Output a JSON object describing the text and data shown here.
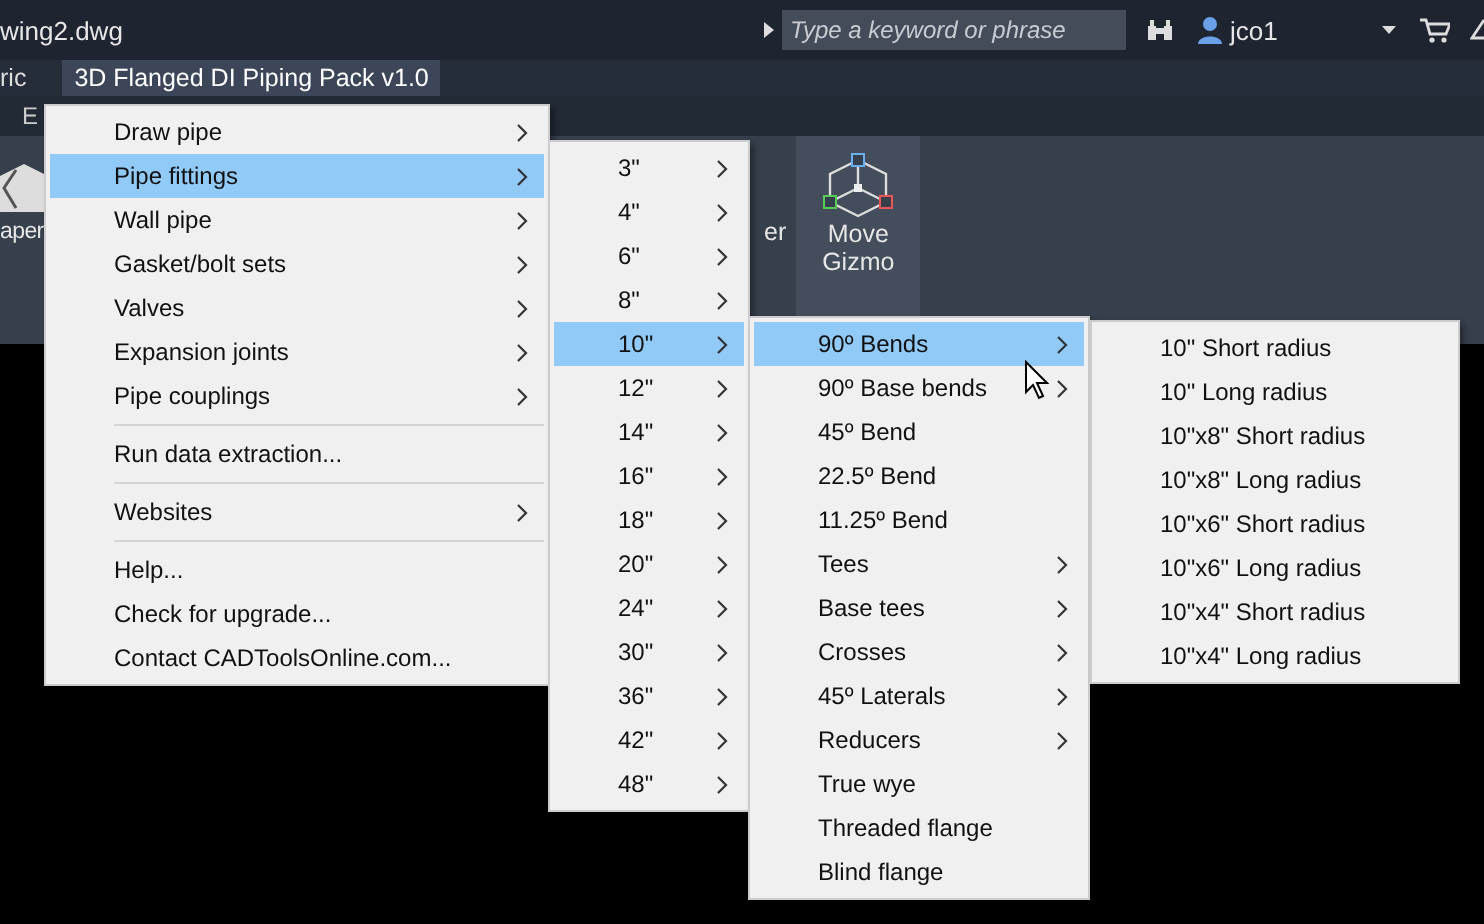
{
  "title_bar": {
    "file_name": "wing2.dwg",
    "search": {
      "placeholder": "Type a keyword or phrase"
    },
    "user": "jco1"
  },
  "menu_bar": {
    "items": [
      {
        "label": "ric",
        "selected": false
      },
      {
        "label": "3D Flanged DI Piping Pack v1.0",
        "selected": true
      }
    ]
  },
  "ribbon": {
    "tabs": [
      {
        "label": "E"
      }
    ],
    "buttons": [
      {
        "label": "aper"
      },
      {
        "label": "er"
      },
      {
        "label": "Move Gizmo"
      }
    ]
  },
  "menus": [
    {
      "items": [
        {
          "kind": "item",
          "label": "Draw pipe",
          "submenu": true,
          "selected": false
        },
        {
          "kind": "item",
          "label": "Pipe fittings",
          "submenu": true,
          "selected": true
        },
        {
          "kind": "item",
          "label": "Wall pipe",
          "submenu": true,
          "selected": false
        },
        {
          "kind": "item",
          "label": "Gasket/bolt sets",
          "submenu": true,
          "selected": false
        },
        {
          "kind": "item",
          "label": "Valves",
          "submenu": true,
          "selected": false
        },
        {
          "kind": "item",
          "label": "Expansion joints",
          "submenu": true,
          "selected": false
        },
        {
          "kind": "item",
          "label": "Pipe couplings",
          "submenu": true,
          "selected": false
        },
        {
          "kind": "separator"
        },
        {
          "kind": "item",
          "label": "Run data extraction...",
          "submenu": false,
          "selected": false
        },
        {
          "kind": "separator"
        },
        {
          "kind": "item",
          "label": "Websites",
          "submenu": true,
          "selected": false
        },
        {
          "kind": "separator"
        },
        {
          "kind": "item",
          "label": "Help...",
          "submenu": false,
          "selected": false
        },
        {
          "kind": "item",
          "label": "Check for upgrade...",
          "submenu": false,
          "selected": false
        },
        {
          "kind": "item",
          "label": "Contact CADToolsOnline.com...",
          "submenu": false,
          "selected": false
        }
      ]
    },
    {
      "items": [
        {
          "kind": "item",
          "label": "3\"",
          "submenu": true,
          "selected": false
        },
        {
          "kind": "item",
          "label": "4\"",
          "submenu": true,
          "selected": false
        },
        {
          "kind": "item",
          "label": "6\"",
          "submenu": true,
          "selected": false
        },
        {
          "kind": "item",
          "label": "8\"",
          "submenu": true,
          "selected": false
        },
        {
          "kind": "item",
          "label": "10\"",
          "submenu": true,
          "selected": true
        },
        {
          "kind": "item",
          "label": "12\"",
          "submenu": true,
          "selected": false
        },
        {
          "kind": "item",
          "label": "14\"",
          "submenu": true,
          "selected": false
        },
        {
          "kind": "item",
          "label": "16\"",
          "submenu": true,
          "selected": false
        },
        {
          "kind": "item",
          "label": "18\"",
          "submenu": true,
          "selected": false
        },
        {
          "kind": "item",
          "label": "20\"",
          "submenu": true,
          "selected": false
        },
        {
          "kind": "item",
          "label": "24\"",
          "submenu": true,
          "selected": false
        },
        {
          "kind": "item",
          "label": "30\"",
          "submenu": true,
          "selected": false
        },
        {
          "kind": "item",
          "label": "36\"",
          "submenu": true,
          "selected": false
        },
        {
          "kind": "item",
          "label": "42\"",
          "submenu": true,
          "selected": false
        },
        {
          "kind": "item",
          "label": "48\"",
          "submenu": true,
          "selected": false
        }
      ]
    },
    {
      "items": [
        {
          "kind": "item",
          "label": "90º Bends",
          "submenu": true,
          "selected": true
        },
        {
          "kind": "item",
          "label": "90º Base bends",
          "submenu": true,
          "selected": false
        },
        {
          "kind": "item",
          "label": "45º Bend",
          "submenu": false,
          "selected": false
        },
        {
          "kind": "item",
          "label": "22.5º Bend",
          "submenu": false,
          "selected": false
        },
        {
          "kind": "item",
          "label": "11.25º Bend",
          "submenu": false,
          "selected": false
        },
        {
          "kind": "item",
          "label": "Tees",
          "submenu": true,
          "selected": false
        },
        {
          "kind": "item",
          "label": "Base tees",
          "submenu": true,
          "selected": false
        },
        {
          "kind": "item",
          "label": "Crosses",
          "submenu": true,
          "selected": false
        },
        {
          "kind": "item",
          "label": "45º Laterals",
          "submenu": true,
          "selected": false
        },
        {
          "kind": "item",
          "label": "Reducers",
          "submenu": true,
          "selected": false
        },
        {
          "kind": "item",
          "label": "True wye",
          "submenu": false,
          "selected": false
        },
        {
          "kind": "item",
          "label": "Threaded flange",
          "submenu": false,
          "selected": false
        },
        {
          "kind": "item",
          "label": "Blind flange",
          "submenu": false,
          "selected": false
        }
      ]
    },
    {
      "items": [
        {
          "kind": "item",
          "label": "10\" Short radius",
          "submenu": false,
          "selected": false
        },
        {
          "kind": "item",
          "label": "10\" Long radius",
          "submenu": false,
          "selected": false
        },
        {
          "kind": "item",
          "label": "10\"x8\" Short radius",
          "submenu": false,
          "selected": false
        },
        {
          "kind": "item",
          "label": "10\"x8\" Long radius",
          "submenu": false,
          "selected": false
        },
        {
          "kind": "item",
          "label": "10\"x6\" Short radius",
          "submenu": false,
          "selected": false
        },
        {
          "kind": "item",
          "label": "10\"x6\" Long radius",
          "submenu": false,
          "selected": false
        },
        {
          "kind": "item",
          "label": "10\"x4\" Short radius",
          "submenu": false,
          "selected": false
        },
        {
          "kind": "item",
          "label": "10\"x4\" Long radius",
          "submenu": false,
          "selected": false
        }
      ]
    }
  ]
}
